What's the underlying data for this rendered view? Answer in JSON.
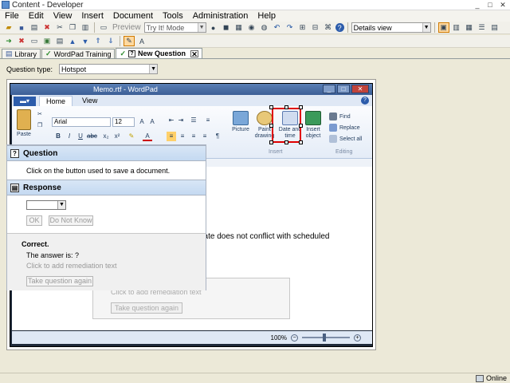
{
  "window": {
    "title": "Content - Developer",
    "min": "_",
    "max": "□",
    "close": "✕"
  },
  "menu": [
    "File",
    "Edit",
    "View",
    "Insert",
    "Document",
    "Tools",
    "Administration",
    "Help"
  ],
  "toolbar": {
    "preview_label": "Preview",
    "mode_value": "Try It! Mode",
    "view_value": "Details view"
  },
  "tabs": [
    {
      "label": "Library"
    },
    {
      "label": "WordPad Training"
    },
    {
      "label": "New Question",
      "close": "✕"
    }
  ],
  "question_type": {
    "label": "Question type:",
    "value": "Hotspot"
  },
  "wordpad": {
    "title": "Memo.rtf - WordPad",
    "ribbon_tabs": [
      "Home",
      "View"
    ],
    "help": "?",
    "font_name": "Arial",
    "font_size": "12",
    "paste_label": "Paste",
    "picture_label": "Picture",
    "paint_label": "Paint drawing",
    "datetime_label": "Date and time",
    "insert_object_label": "Insert object",
    "insert_group": "Insert",
    "find_label": "Find",
    "replace_label": "Replace",
    "select_all_label": "Select all",
    "editing_group": "Editing",
    "doc_text": "date does not conflict with scheduled",
    "zoom": "100%"
  },
  "ghost": {
    "remediation": "Click to add remediation text",
    "take_again": "Take question again"
  },
  "panel": {
    "question_header": "Question",
    "question_text": "Click on the button used to save a document.",
    "response_header": "Response",
    "ok_label": "OK",
    "dont_know_label": "Do Not Know",
    "feedback_title": "Correct.",
    "answer_text": "The answer is: ?",
    "remediation": "Click to add remediation text",
    "take_again": "Take question again"
  },
  "status": {
    "online": "Online"
  }
}
